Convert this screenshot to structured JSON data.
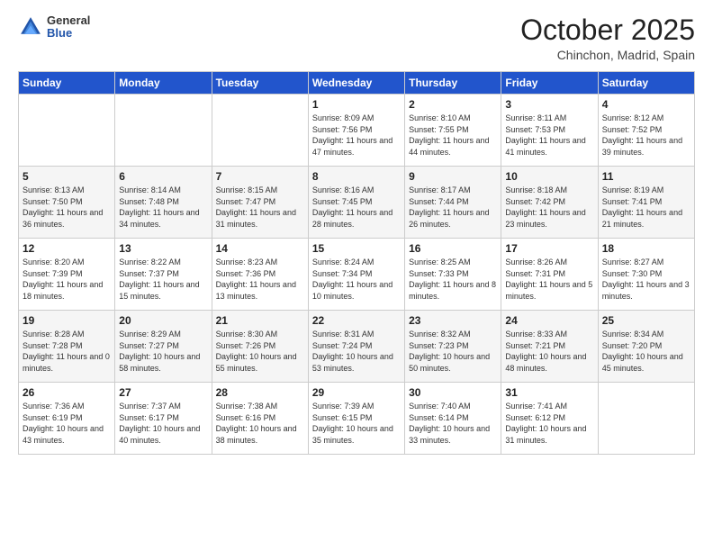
{
  "header": {
    "logo_general": "General",
    "logo_blue": "Blue",
    "month_year": "October 2025",
    "location": "Chinchon, Madrid, Spain"
  },
  "weekdays": [
    "Sunday",
    "Monday",
    "Tuesday",
    "Wednesday",
    "Thursday",
    "Friday",
    "Saturday"
  ],
  "weeks": [
    [
      {
        "day": "",
        "sunrise": "",
        "sunset": "",
        "daylight": ""
      },
      {
        "day": "",
        "sunrise": "",
        "sunset": "",
        "daylight": ""
      },
      {
        "day": "",
        "sunrise": "",
        "sunset": "",
        "daylight": ""
      },
      {
        "day": "1",
        "sunrise": "Sunrise: 8:09 AM",
        "sunset": "Sunset: 7:56 PM",
        "daylight": "Daylight: 11 hours and 47 minutes."
      },
      {
        "day": "2",
        "sunrise": "Sunrise: 8:10 AM",
        "sunset": "Sunset: 7:55 PM",
        "daylight": "Daylight: 11 hours and 44 minutes."
      },
      {
        "day": "3",
        "sunrise": "Sunrise: 8:11 AM",
        "sunset": "Sunset: 7:53 PM",
        "daylight": "Daylight: 11 hours and 41 minutes."
      },
      {
        "day": "4",
        "sunrise": "Sunrise: 8:12 AM",
        "sunset": "Sunset: 7:52 PM",
        "daylight": "Daylight: 11 hours and 39 minutes."
      }
    ],
    [
      {
        "day": "5",
        "sunrise": "Sunrise: 8:13 AM",
        "sunset": "Sunset: 7:50 PM",
        "daylight": "Daylight: 11 hours and 36 minutes."
      },
      {
        "day": "6",
        "sunrise": "Sunrise: 8:14 AM",
        "sunset": "Sunset: 7:48 PM",
        "daylight": "Daylight: 11 hours and 34 minutes."
      },
      {
        "day": "7",
        "sunrise": "Sunrise: 8:15 AM",
        "sunset": "Sunset: 7:47 PM",
        "daylight": "Daylight: 11 hours and 31 minutes."
      },
      {
        "day": "8",
        "sunrise": "Sunrise: 8:16 AM",
        "sunset": "Sunset: 7:45 PM",
        "daylight": "Daylight: 11 hours and 28 minutes."
      },
      {
        "day": "9",
        "sunrise": "Sunrise: 8:17 AM",
        "sunset": "Sunset: 7:44 PM",
        "daylight": "Daylight: 11 hours and 26 minutes."
      },
      {
        "day": "10",
        "sunrise": "Sunrise: 8:18 AM",
        "sunset": "Sunset: 7:42 PM",
        "daylight": "Daylight: 11 hours and 23 minutes."
      },
      {
        "day": "11",
        "sunrise": "Sunrise: 8:19 AM",
        "sunset": "Sunset: 7:41 PM",
        "daylight": "Daylight: 11 hours and 21 minutes."
      }
    ],
    [
      {
        "day": "12",
        "sunrise": "Sunrise: 8:20 AM",
        "sunset": "Sunset: 7:39 PM",
        "daylight": "Daylight: 11 hours and 18 minutes."
      },
      {
        "day": "13",
        "sunrise": "Sunrise: 8:22 AM",
        "sunset": "Sunset: 7:37 PM",
        "daylight": "Daylight: 11 hours and 15 minutes."
      },
      {
        "day": "14",
        "sunrise": "Sunrise: 8:23 AM",
        "sunset": "Sunset: 7:36 PM",
        "daylight": "Daylight: 11 hours and 13 minutes."
      },
      {
        "day": "15",
        "sunrise": "Sunrise: 8:24 AM",
        "sunset": "Sunset: 7:34 PM",
        "daylight": "Daylight: 11 hours and 10 minutes."
      },
      {
        "day": "16",
        "sunrise": "Sunrise: 8:25 AM",
        "sunset": "Sunset: 7:33 PM",
        "daylight": "Daylight: 11 hours and 8 minutes."
      },
      {
        "day": "17",
        "sunrise": "Sunrise: 8:26 AM",
        "sunset": "Sunset: 7:31 PM",
        "daylight": "Daylight: 11 hours and 5 minutes."
      },
      {
        "day": "18",
        "sunrise": "Sunrise: 8:27 AM",
        "sunset": "Sunset: 7:30 PM",
        "daylight": "Daylight: 11 hours and 3 minutes."
      }
    ],
    [
      {
        "day": "19",
        "sunrise": "Sunrise: 8:28 AM",
        "sunset": "Sunset: 7:28 PM",
        "daylight": "Daylight: 11 hours and 0 minutes."
      },
      {
        "day": "20",
        "sunrise": "Sunrise: 8:29 AM",
        "sunset": "Sunset: 7:27 PM",
        "daylight": "Daylight: 10 hours and 58 minutes."
      },
      {
        "day": "21",
        "sunrise": "Sunrise: 8:30 AM",
        "sunset": "Sunset: 7:26 PM",
        "daylight": "Daylight: 10 hours and 55 minutes."
      },
      {
        "day": "22",
        "sunrise": "Sunrise: 8:31 AM",
        "sunset": "Sunset: 7:24 PM",
        "daylight": "Daylight: 10 hours and 53 minutes."
      },
      {
        "day": "23",
        "sunrise": "Sunrise: 8:32 AM",
        "sunset": "Sunset: 7:23 PM",
        "daylight": "Daylight: 10 hours and 50 minutes."
      },
      {
        "day": "24",
        "sunrise": "Sunrise: 8:33 AM",
        "sunset": "Sunset: 7:21 PM",
        "daylight": "Daylight: 10 hours and 48 minutes."
      },
      {
        "day": "25",
        "sunrise": "Sunrise: 8:34 AM",
        "sunset": "Sunset: 7:20 PM",
        "daylight": "Daylight: 10 hours and 45 minutes."
      }
    ],
    [
      {
        "day": "26",
        "sunrise": "Sunrise: 7:36 AM",
        "sunset": "Sunset: 6:19 PM",
        "daylight": "Daylight: 10 hours and 43 minutes."
      },
      {
        "day": "27",
        "sunrise": "Sunrise: 7:37 AM",
        "sunset": "Sunset: 6:17 PM",
        "daylight": "Daylight: 10 hours and 40 minutes."
      },
      {
        "day": "28",
        "sunrise": "Sunrise: 7:38 AM",
        "sunset": "Sunset: 6:16 PM",
        "daylight": "Daylight: 10 hours and 38 minutes."
      },
      {
        "day": "29",
        "sunrise": "Sunrise: 7:39 AM",
        "sunset": "Sunset: 6:15 PM",
        "daylight": "Daylight: 10 hours and 35 minutes."
      },
      {
        "day": "30",
        "sunrise": "Sunrise: 7:40 AM",
        "sunset": "Sunset: 6:14 PM",
        "daylight": "Daylight: 10 hours and 33 minutes."
      },
      {
        "day": "31",
        "sunrise": "Sunrise: 7:41 AM",
        "sunset": "Sunset: 6:12 PM",
        "daylight": "Daylight: 10 hours and 31 minutes."
      },
      {
        "day": "",
        "sunrise": "",
        "sunset": "",
        "daylight": ""
      }
    ]
  ]
}
